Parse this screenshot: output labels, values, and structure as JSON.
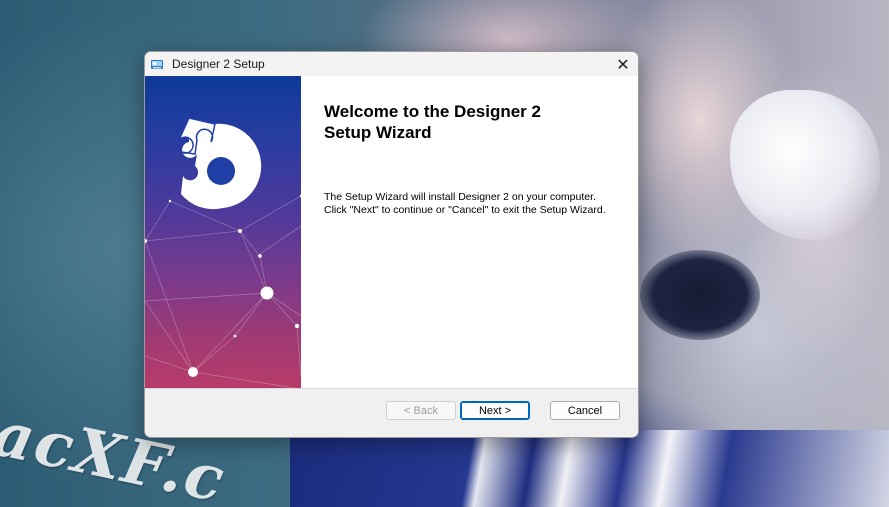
{
  "window": {
    "title": "Designer 2 Setup",
    "close_glyph": "✕"
  },
  "wizard": {
    "heading_line1": "Welcome to the Designer 2",
    "heading_line2": "Setup Wizard",
    "description_line1": "The Setup Wizard will install Designer 2 on your computer.",
    "description_line2": "Click \"Next\" to continue or \"Cancel\" to exit the Setup Wizard."
  },
  "buttons": {
    "back_label": "< Back",
    "next_label": "Next >",
    "cancel_label": "Cancel"
  },
  "desktop": {
    "watermark": "acXF.c"
  },
  "icons": {
    "app": "installer-app-icon",
    "logo": "puzzle-d-logo-icon",
    "close": "close-icon"
  },
  "colors": {
    "banner_top": "#0e3a9a",
    "banner_bottom": "#b73b6a",
    "default_button_border": "#0067c0"
  }
}
